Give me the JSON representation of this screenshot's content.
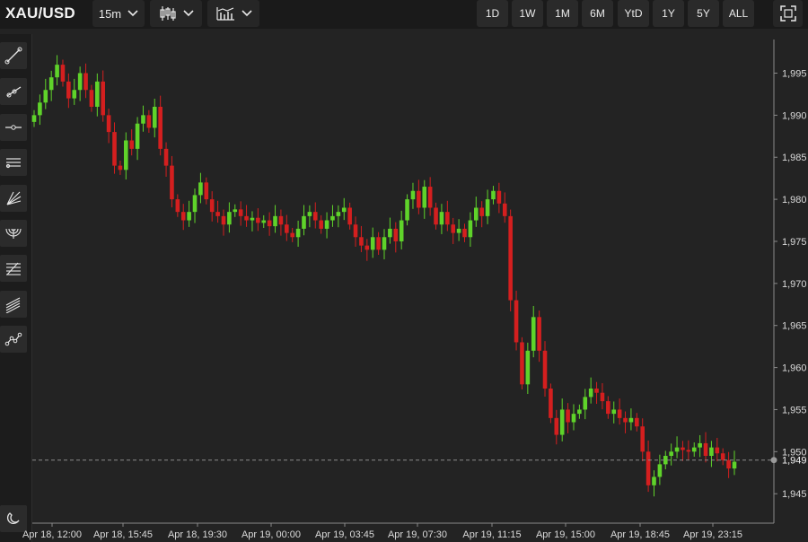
{
  "header": {
    "symbol": "XAU/USD",
    "interval": "15m",
    "chart_type_icon": "candlestick-icon",
    "indicators_icon": "indicators-icon",
    "ranges": [
      "1D",
      "1W",
      "1M",
      "6M",
      "YtD",
      "1Y",
      "5Y",
      "ALL"
    ],
    "fullscreen_icon": "fullscreen-icon"
  },
  "tools": [
    "trend-line-icon",
    "ray-icon",
    "horizontal-line-icon",
    "parallel-channel-icon",
    "fib-fan-icon",
    "fib-arc-icon",
    "fib-retracement-icon",
    "fib-channel-icon",
    "polyline-icon",
    "magnet-icon"
  ],
  "colors": {
    "up": "#5fd32a",
    "down": "#d41f1f",
    "axis": "#9a9a9a",
    "background": "#232323",
    "grid": "#2d2d2d"
  },
  "chart_data": {
    "type": "candlestick",
    "x_labels": [
      "Apr 18, 12:00",
      "Apr 18, 15:45",
      "Apr 18, 19:30",
      "Apr 19, 00:00",
      "Apr 19, 03:45",
      "Apr 19, 07:30",
      "Apr 19, 11:15",
      "Apr 19, 15:00",
      "Apr 19, 18:45",
      "Apr 19, 23:15"
    ],
    "y_ticks": [
      "1,995",
      "1,990",
      "1,985",
      "1,980",
      "1,975",
      "1,970",
      "1,965",
      "1,960",
      "1,955",
      "1,950",
      "1,945"
    ],
    "ylim": [
      1941.5,
      1999
    ],
    "last_price": 1949,
    "last_price_label": "1,949",
    "series_close": [
      1990,
      1991.5,
      1993,
      1994.5,
      1996,
      1994,
      1992,
      1993,
      1995,
      1993,
      1991,
      1994,
      1990,
      1988,
      1984,
      1983.5,
      1987,
      1986,
      1989,
      1990,
      1988.5,
      1991,
      1986,
      1984,
      1980,
      1978.5,
      1977.5,
      1978.5,
      1980.5,
      1982,
      1980,
      1978.5,
      1978,
      1977,
      1978.5,
      1978.8,
      1978,
      1977.5,
      1977.8,
      1977.2,
      1977.5,
      1976.8,
      1978,
      1977,
      1976,
      1975.5,
      1976.5,
      1978,
      1978.5,
      1977.5,
      1976.5,
      1977.5,
      1978,
      1978.5,
      1979,
      1977,
      1975.5,
      1974.5,
      1974,
      1975.5,
      1974,
      1975.5,
      1976.5,
      1975,
      1977.5,
      1980,
      1981,
      1979,
      1981.5,
      1979,
      1977,
      1978.5,
      1977,
      1976,
      1976.5,
      1975.5,
      1977.5,
      1979,
      1978,
      1980,
      1981,
      1979.5,
      1978,
      1968,
      1963,
      1958,
      1962,
      1966,
      1962,
      1957.5,
      1954,
      1952,
      1955,
      1953.5,
      1954.5,
      1955,
      1956.5,
      1957.5,
      1957,
      1956,
      1954.5,
      1955,
      1954,
      1953.5,
      1954,
      1953,
      1950,
      1946,
      1947,
      1948.5,
      1949.5,
      1950,
      1950.5,
      1950.2,
      1950,
      1950.5,
      1951,
      1949.5,
      1950.5,
      1949.8,
      1949,
      1948,
      1948.8
    ]
  }
}
